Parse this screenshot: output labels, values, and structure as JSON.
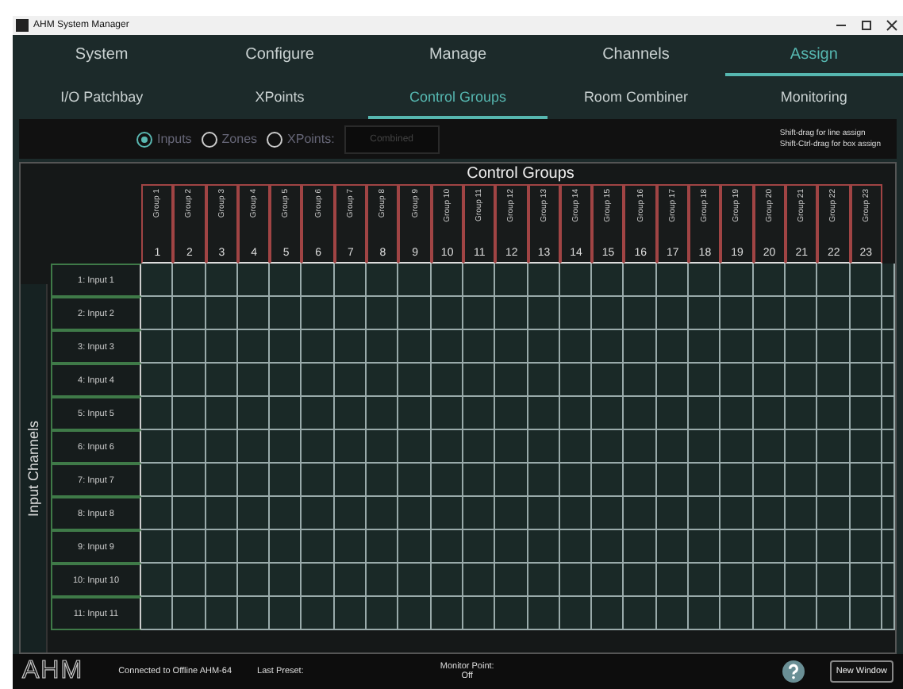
{
  "window": {
    "title": "AHM System Manager"
  },
  "main_tabs": [
    {
      "label": "System",
      "selected": false
    },
    {
      "label": "Configure",
      "selected": false
    },
    {
      "label": "Manage",
      "selected": false
    },
    {
      "label": "Channels",
      "selected": false
    },
    {
      "label": "Assign",
      "selected": true
    }
  ],
  "sub_tabs": [
    {
      "label": "I/O Patchbay",
      "selected": false
    },
    {
      "label": "XPoints",
      "selected": false
    },
    {
      "label": "Control Groups",
      "selected": true
    },
    {
      "label": "Room Combiner",
      "selected": false
    },
    {
      "label": "Monitoring",
      "selected": false
    }
  ],
  "view_options": [
    {
      "label": "Inputs",
      "selected": true
    },
    {
      "label": "Zones",
      "selected": false
    },
    {
      "label": "XPoints:",
      "selected": false
    }
  ],
  "xpoints_field": {
    "value": "Combined"
  },
  "hints": [
    "Shift-drag for line assign",
    "Shift-Ctrl-drag for box assign"
  ],
  "grid": {
    "title": "Control Groups",
    "row_axis_title": "Input Channels",
    "columns": [
      {
        "name": "Group 1",
        "number": "1"
      },
      {
        "name": "Group 2",
        "number": "2"
      },
      {
        "name": "Group 3",
        "number": "3"
      },
      {
        "name": "Group 4",
        "number": "4"
      },
      {
        "name": "Group 5",
        "number": "5"
      },
      {
        "name": "Group 6",
        "number": "6"
      },
      {
        "name": "Group 7",
        "number": "7"
      },
      {
        "name": "Group 8",
        "number": "8"
      },
      {
        "name": "Group 9",
        "number": "9"
      },
      {
        "name": "Group 10",
        "number": "10"
      },
      {
        "name": "Group 11",
        "number": "11"
      },
      {
        "name": "Group 12",
        "number": "12"
      },
      {
        "name": "Group 13",
        "number": "13"
      },
      {
        "name": "Group 14",
        "number": "14"
      },
      {
        "name": "Group 15",
        "number": "15"
      },
      {
        "name": "Group 16",
        "number": "16"
      },
      {
        "name": "Group 17",
        "number": "17"
      },
      {
        "name": "Group 18",
        "number": "18"
      },
      {
        "name": "Group 19",
        "number": "19"
      },
      {
        "name": "Group 20",
        "number": "20"
      },
      {
        "name": "Group 21",
        "number": "21"
      },
      {
        "name": "Group 22",
        "number": "22"
      },
      {
        "name": "Group 23",
        "number": "23"
      }
    ],
    "rows": [
      "1: Input 1",
      "2: Input 2",
      "3: Input 3",
      "4: Input 4",
      "5: Input 5",
      "6: Input 6",
      "7: Input 7",
      "8: Input 8",
      "9: Input 9",
      "10: Input 10",
      "11: Input 11"
    ]
  },
  "status_bar": {
    "logo": "AHM",
    "connection": "Connected to Offline AHM-64",
    "last_preset": "Last Preset:",
    "monitor_point": "Monitor Point:",
    "monitor_value": "Off",
    "button": "New Window"
  }
}
